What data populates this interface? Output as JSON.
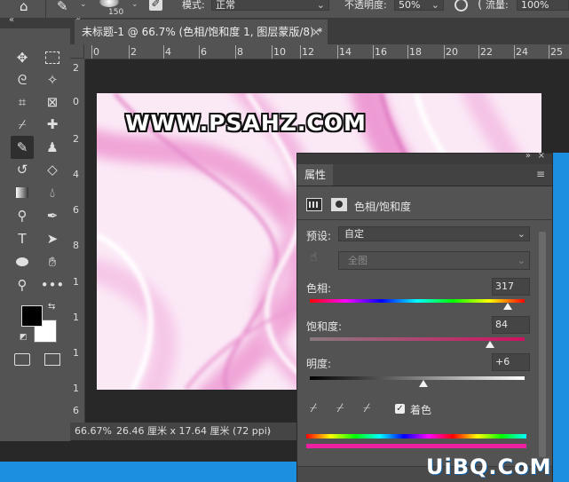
{
  "options_bar": {
    "brush_size": "150",
    "mode_label": "模式:",
    "mode_value": "正常",
    "opacity_label": "不透明度:",
    "opacity_value": "50%",
    "flow_label": "流量:",
    "flow_value": "100%"
  },
  "document_tab": {
    "title": "未标题-1 @ 66.7% (色相/饱和度 1, 图层蒙版/8) *",
    "close": "×"
  },
  "ruler_top": {
    "ticks": [
      "2",
      "0",
      "2",
      "4",
      "6",
      "8",
      "10",
      "12",
      "14",
      "16",
      "18",
      "20",
      "22",
      "24",
      "25"
    ]
  },
  "ruler_left": {
    "ticks": [
      "2",
      "0",
      "2",
      "4",
      "6",
      "8",
      "1",
      "1",
      "1",
      "1",
      "6"
    ]
  },
  "image": {
    "watermark": "WWW.PSAHZ.COM"
  },
  "status_bar": {
    "zoom": "66.67%",
    "doc_info": "26.46 厘米 x 17.64 厘米 (72 ppi)",
    "arrow": "›"
  },
  "properties_panel": {
    "tab_label": "属性",
    "adjustment_name": "色相/饱和度",
    "preset_label": "预设:",
    "preset_value": "自定",
    "channel_value": "全图",
    "hue_label": "色相:",
    "hue_value": "317",
    "hue_fraction": 0.92,
    "saturation_label": "饱和度:",
    "saturation_value": "84",
    "saturation_fraction": 0.84,
    "lightness_label": "明度:",
    "lightness_value": "+6",
    "lightness_fraction": 0.53,
    "colorize_label": "着色",
    "colorize_checked": true
  },
  "brand_watermark": "UiBQ.CoM",
  "colors": {
    "panel_bg": "#535353",
    "dark_bg": "#282828",
    "accent_blue": "#1c8fe0",
    "image_pink": "#f0a9dc"
  }
}
